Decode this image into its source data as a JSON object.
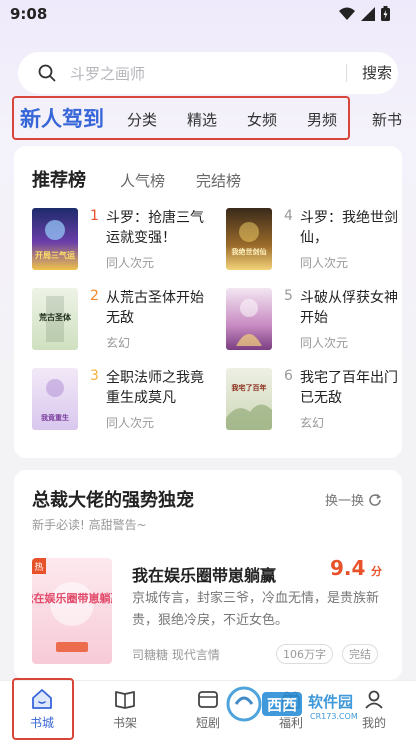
{
  "status_bar": {
    "time": "9:08"
  },
  "search": {
    "placeholder": "斗罗之画师",
    "button_label": "搜索"
  },
  "tabs": [
    {
      "label": "新人驾到",
      "active": true
    },
    {
      "label": "分类"
    },
    {
      "label": "精选"
    },
    {
      "label": "女频"
    },
    {
      "label": "男频"
    },
    {
      "label": "新书"
    }
  ],
  "ranking": {
    "tabs": [
      {
        "label": "推荐榜",
        "active": true
      },
      {
        "label": "人气榜"
      },
      {
        "label": "完结榜"
      }
    ],
    "items": [
      {
        "rank": "1",
        "title": "斗罗：抢唐三气运就变强！",
        "genre": "同人次元",
        "cover_text": "开局三气运",
        "rank_color": "#e8522b"
      },
      {
        "rank": "2",
        "title": "从荒古圣体开始无敌",
        "genre": "玄幻",
        "cover_text": "荒古圣体",
        "rank_color": "#f08a2c"
      },
      {
        "rank": "3",
        "title": "全职法师之我竟重生成莫凡",
        "genre": "同人次元",
        "cover_text": "我竟重生",
        "rank_color": "#f2b13a"
      },
      {
        "rank": "4",
        "title": "斗罗：我绝世剑仙，",
        "genre": "同人次元",
        "cover_text": "我绝世剑仙",
        "rank_color": "#999999"
      },
      {
        "rank": "5",
        "title": "斗破从俘获女神开始",
        "genre": "同人次元",
        "cover_text": "",
        "rank_color": "#999999"
      },
      {
        "rank": "6",
        "title": "我宅了百年出门已无敌",
        "genre": "玄幻",
        "cover_text": "我宅了百年",
        "rank_color": "#999999"
      }
    ]
  },
  "feature": {
    "heading": "总裁大佬的强势独宠",
    "subtitle": "新手必读! 高甜警告~",
    "refresh_label": "换一换",
    "book": {
      "title": "我在娱乐圈带崽躺赢",
      "score": "9.4",
      "score_unit": "分",
      "description": "京城传言，封家三爷，冷血无情，是贵族新贵，狠绝冷戾，不近女色。",
      "author_meta": "司糖糖 现代言情",
      "word_count_tag": "106万字",
      "status_tag": "完结",
      "cover_text": "我在娱乐圈带崽躺赢",
      "cover_badge": "热"
    }
  },
  "bottom_nav": [
    {
      "label": "书城",
      "icon": "home-icon",
      "active": true
    },
    {
      "label": "书架",
      "icon": "bookshelf-icon"
    },
    {
      "label": "短剧",
      "icon": "tv-icon"
    },
    {
      "label": "福利",
      "icon": "gift-icon"
    },
    {
      "label": "我的",
      "icon": "profile-icon"
    }
  ],
  "watermark": {
    "brand": "西西",
    "site_name": "软件园",
    "url": "CR173.COM"
  },
  "colors": {
    "accent": "#3766d8",
    "highlight_box": "#d8463a",
    "score": "#e8522b"
  }
}
